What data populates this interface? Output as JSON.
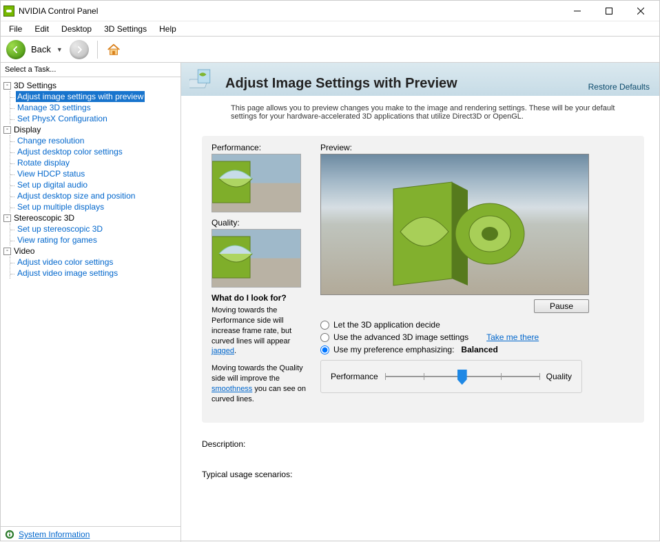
{
  "titlebar": {
    "title": "NVIDIA Control Panel"
  },
  "menubar": [
    "File",
    "Edit",
    "Desktop",
    "3D Settings",
    "Help"
  ],
  "toolbar": {
    "back": "Back"
  },
  "sidebar": {
    "heading": "Select a Task...",
    "categories": [
      {
        "name": "3D Settings",
        "items": [
          "Adjust image settings with preview",
          "Manage 3D settings",
          "Set PhysX Configuration"
        ],
        "selected_index": 0
      },
      {
        "name": "Display",
        "items": [
          "Change resolution",
          "Adjust desktop color settings",
          "Rotate display",
          "View HDCP status",
          "Set up digital audio",
          "Adjust desktop size and position",
          "Set up multiple displays"
        ],
        "selected_index": -1
      },
      {
        "name": "Stereoscopic 3D",
        "items": [
          "Set up stereoscopic 3D",
          "View rating for games"
        ],
        "selected_index": -1
      },
      {
        "name": "Video",
        "items": [
          "Adjust video color settings",
          "Adjust video image settings"
        ],
        "selected_index": -1
      }
    ],
    "system_info": "System Information"
  },
  "page": {
    "title": "Adjust Image Settings with Preview",
    "restore": "Restore Defaults",
    "intro": "This page allows you to preview changes you make to the image and rendering settings. These will be your default settings for your hardware-accelerated 3D applications that utilize Direct3D or OpenGL.",
    "left": {
      "perf_label": "Performance:",
      "quality_label": "Quality:",
      "what_head": "What do I look for?",
      "help1a": "Moving towards the Performance side will increase frame rate, but curved lines will appear ",
      "help1_link": "jagged",
      "help1b": ".",
      "help2a": "Moving towards the Quality side will improve the ",
      "help2_link": "smoothness",
      "help2b": " you can see on curved lines."
    },
    "right": {
      "preview_label": "Preview:",
      "pause": "Pause",
      "radio1": "Let the 3D application decide",
      "radio2": "Use the advanced 3D image settings",
      "take_link": "Take me there",
      "radio3": "Use my preference emphasizing:",
      "balanced": "Balanced",
      "slider_left": "Performance",
      "slider_right": "Quality"
    },
    "desc_label": "Description:",
    "usage_label": "Typical usage scenarios:"
  }
}
